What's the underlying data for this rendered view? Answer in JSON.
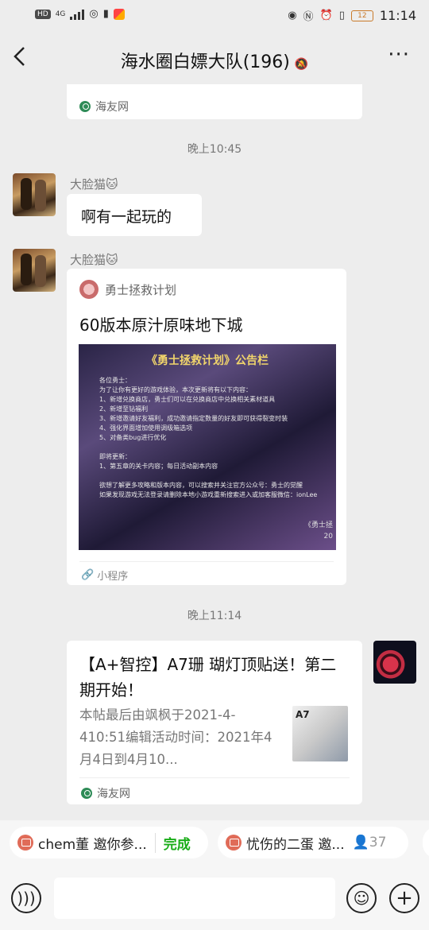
{
  "status": {
    "left_badges": [
      "HD",
      "4G"
    ],
    "time": "11:14",
    "battery": "12"
  },
  "header": {
    "back_icon": "chevron-left-icon",
    "title": "海水圈白嫖大队(196)",
    "mute_icon": "bell-off-icon",
    "more_icon": "more-dots-icon"
  },
  "messages": {
    "top_card_source": "海友网",
    "time1": "晚上10:45",
    "msg1": {
      "sender": "大脸猫🐱",
      "text": "啊有一起玩的"
    },
    "msg2": {
      "sender": "大脸猫🐱",
      "app_name": "勇士拯救计划",
      "title": "60版本原汁原味地下城",
      "image_title": "《勇士拯救计划》公告栏",
      "image_lines": [
        "各位勇士：",
        "为了让你有更好的游戏体验，本次更新将有以下内容：",
        "1、新增兑换商店，勇士们可以在兑换商店中兑换相关素材道具",
        "2、新增至钻福利",
        "3、新增邀请好友福利，成功邀请指定数量的好友即可获得裂变时装",
        "4、强化界面增加使用调级箱选项",
        "5、对备类bug进行优化",
        "",
        "即将更新：",
        "1、第五章的关卡内容；每日活动副本内容",
        "",
        "欲想了解更多攻略和版本内容，可以搜索并关注官方公众号：勇士的觉醒",
        "如果发现游戏无法登录请删除本地小游戏重新搜索进入或加客服微信：ionLee"
      ],
      "image_sign": "《勇士拯",
      "image_sign2": "20",
      "footer": "小程序"
    },
    "time2": "晚上11:14",
    "msg3": {
      "title": "【A+智控】A7珊 瑚灯顶贴送！第二期开始！",
      "desc": "本帖最后由飒枫于2021-4-410:51编辑活动时间：2021年4月4日到4月10...",
      "thumb_label": "A7",
      "source": "海友网"
    }
  },
  "chips": [
    {
      "text": "chem董 邀你参...",
      "action": "完成"
    },
    {
      "text": "忧伤的二蛋 邀...",
      "count": "37"
    }
  ],
  "inputbar": {
    "voice_icon": "voice-icon",
    "emoji_icon": "emoji-icon",
    "plus_icon": "plus-icon"
  }
}
